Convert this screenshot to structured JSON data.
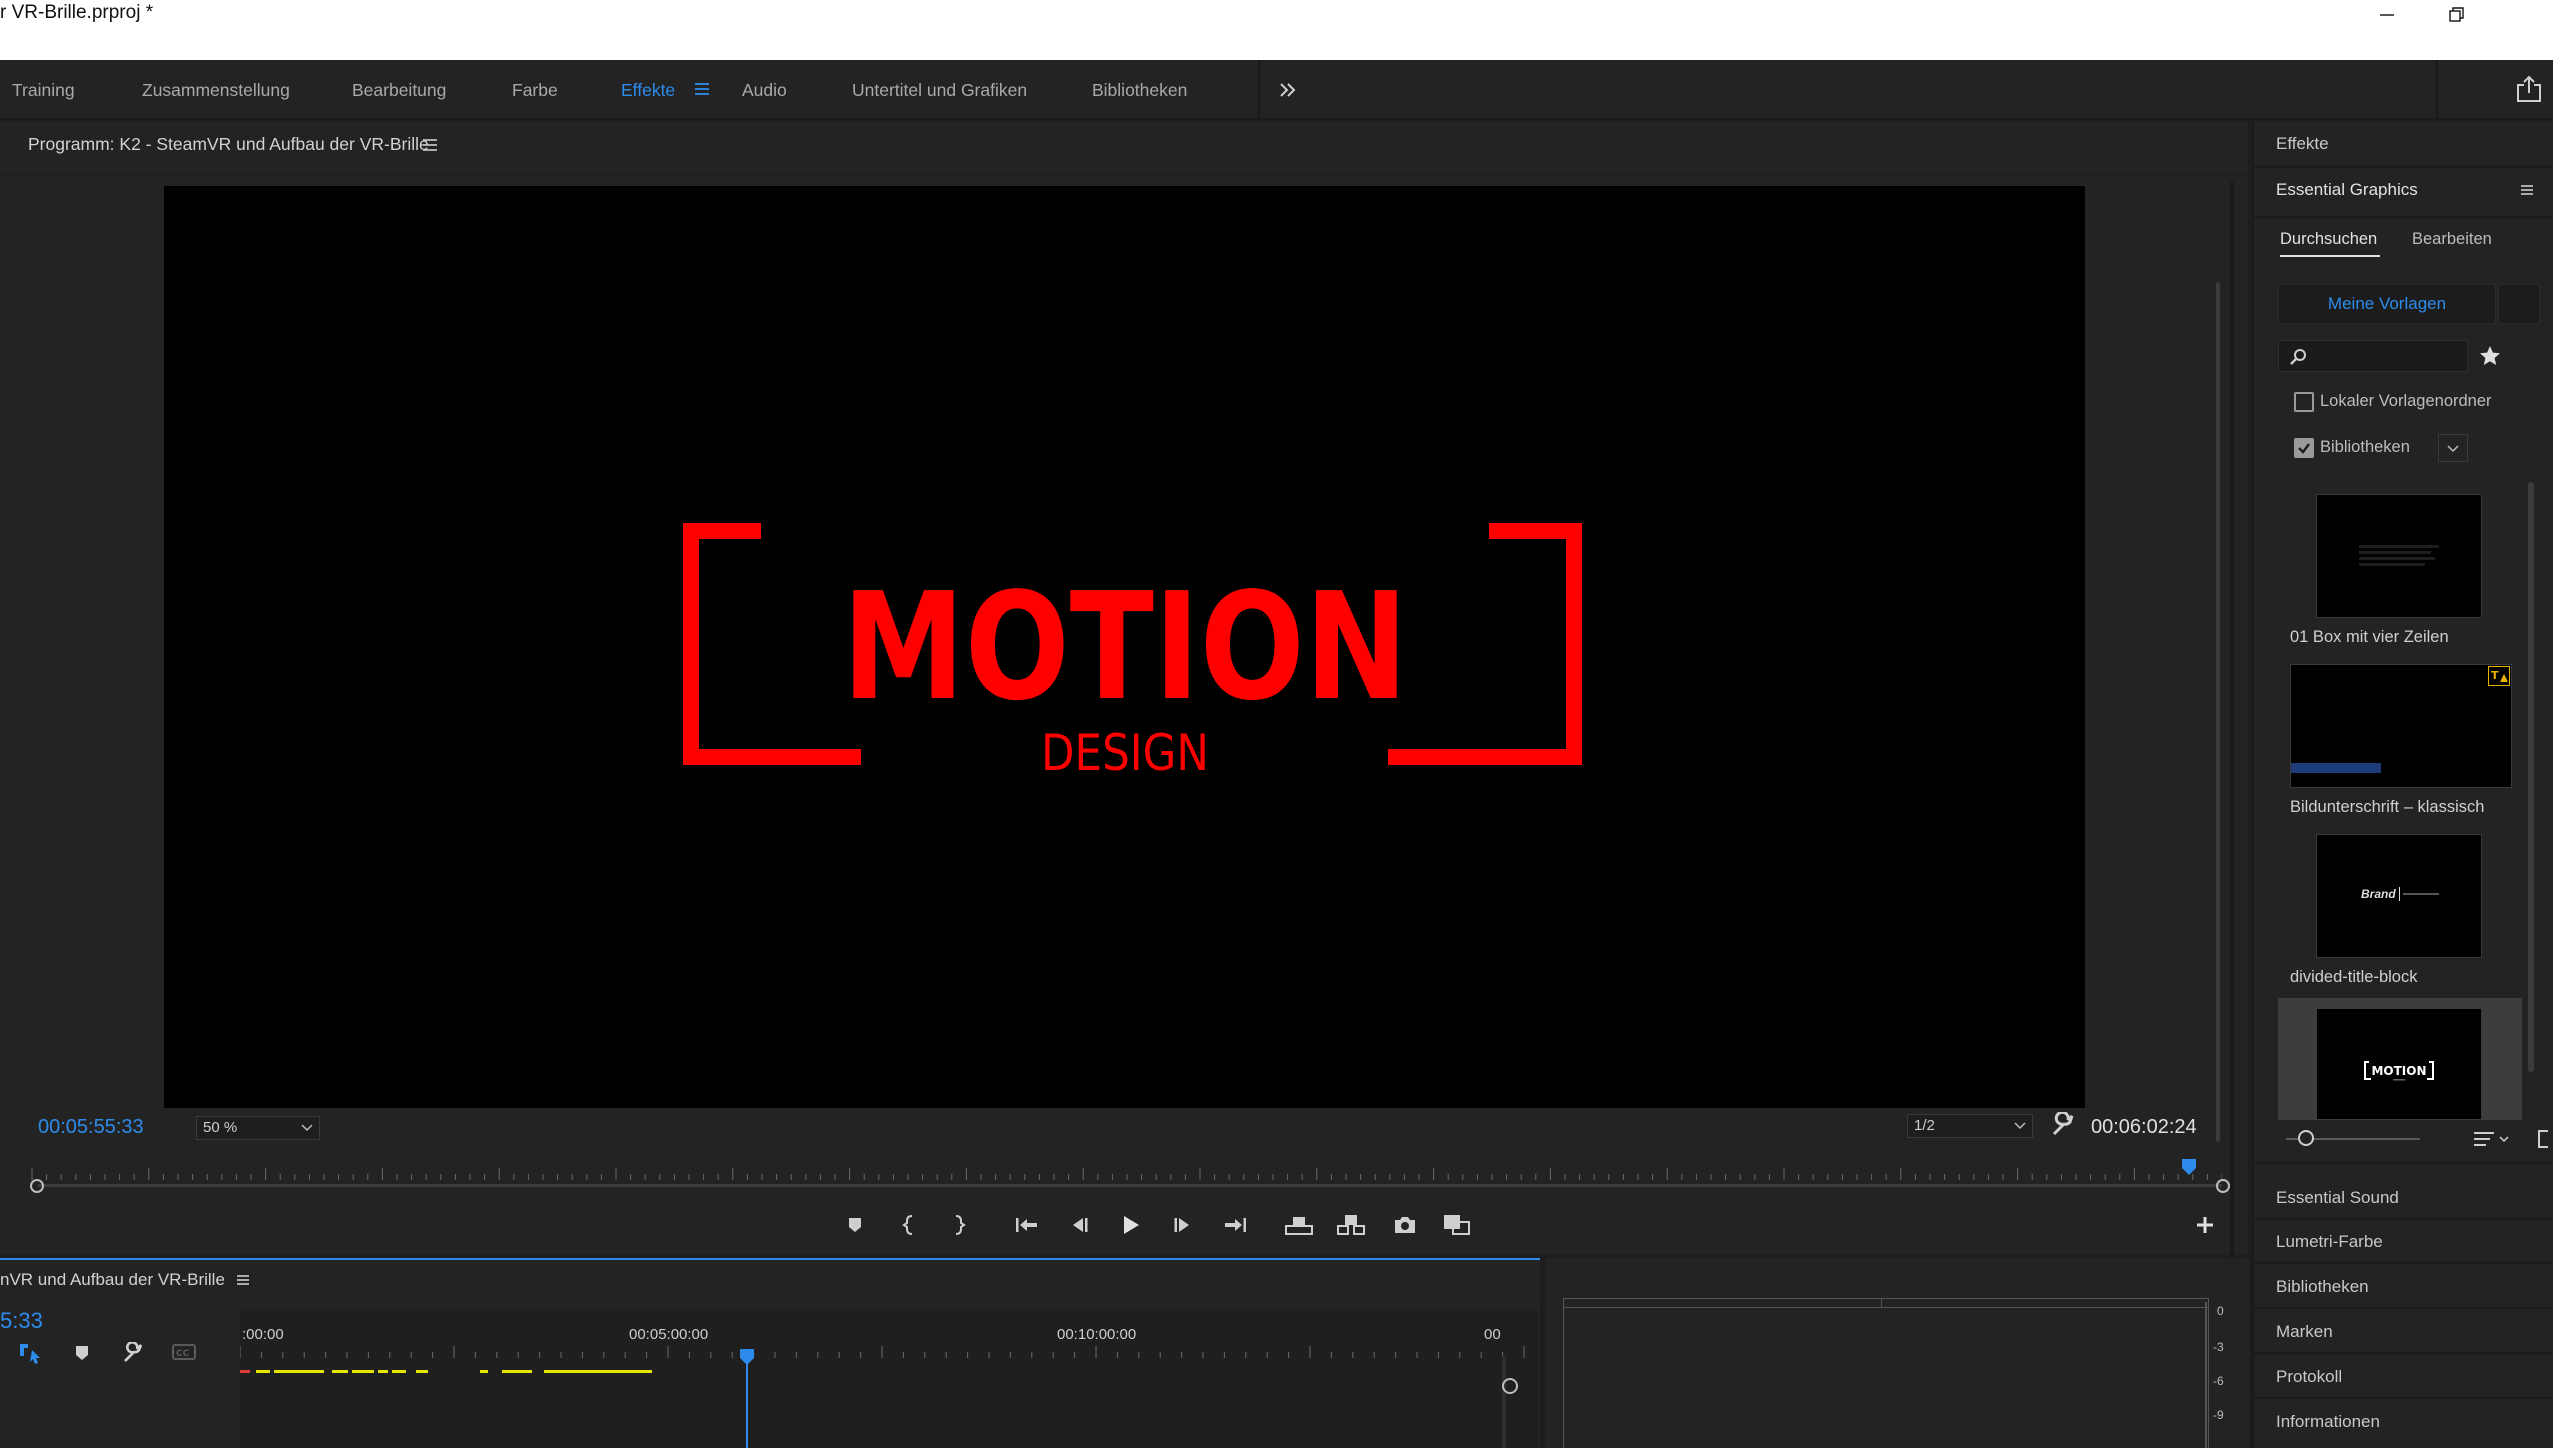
{
  "window": {
    "title": "r VR-Brille.prproj *"
  },
  "workspaces": [
    {
      "label": "Training"
    },
    {
      "label": "Zusammenstellung"
    },
    {
      "label": "Bearbeitung"
    },
    {
      "label": "Farbe"
    },
    {
      "label": "Effekte"
    },
    {
      "label": "Audio"
    },
    {
      "label": "Untertitel und Grafiken"
    },
    {
      "label": "Bibliotheken"
    }
  ],
  "program_monitor": {
    "title": "Programm: K2 - SteamVR und Aufbau der VR-Brille",
    "current_timecode": "00:05:55:33",
    "zoom": "50 %",
    "resolution": "1/2",
    "duration_timecode": "00:06:02:24",
    "playhead_progress": 0.985
  },
  "video_frame": {
    "main_text": "MOTION",
    "sub_text": "DESIGN",
    "accent_color": "#ff0000"
  },
  "essential_graphics": {
    "effects_header": "Effekte",
    "panel_title": "Essential Graphics",
    "tabs": [
      {
        "label": "Durchsuchen"
      },
      {
        "label": "Bearbeiten"
      }
    ],
    "active_tab": "Durchsuchen",
    "templates_button": "Meine Vorlagen",
    "search_placeholder": "",
    "local_folder_label": "Lokaler Vorlagenordner",
    "local_folder_checked": false,
    "libraries_label": "Bibliotheken",
    "libraries_checked": true,
    "templates": [
      {
        "label": "01 Box mit vier Zeilen"
      },
      {
        "label": "Bildunterschrift – klassisch"
      },
      {
        "label": "divided-title-block",
        "thumb_text": "Brand"
      },
      {
        "label": "",
        "thumb_text": "MOTION"
      }
    ],
    "thumb_motion_small": "MOTION"
  },
  "right_panel_sections": [
    {
      "label": "Essential Sound"
    },
    {
      "label": "Lumetri-Farbe"
    },
    {
      "label": "Bibliotheken"
    },
    {
      "label": "Marken"
    },
    {
      "label": "Protokoll"
    },
    {
      "label": "Informationen"
    }
  ],
  "timeline": {
    "sequence_name": "nVR und Aufbau der VR-Brille",
    "timecode_fragment": "5:33",
    "ruler_labels": [
      ":00:00",
      "00:05:00:00",
      "00:10:00:00",
      "00"
    ]
  },
  "audio_meter": {
    "scale": [
      "0",
      "-3",
      "-6",
      "-9"
    ]
  }
}
